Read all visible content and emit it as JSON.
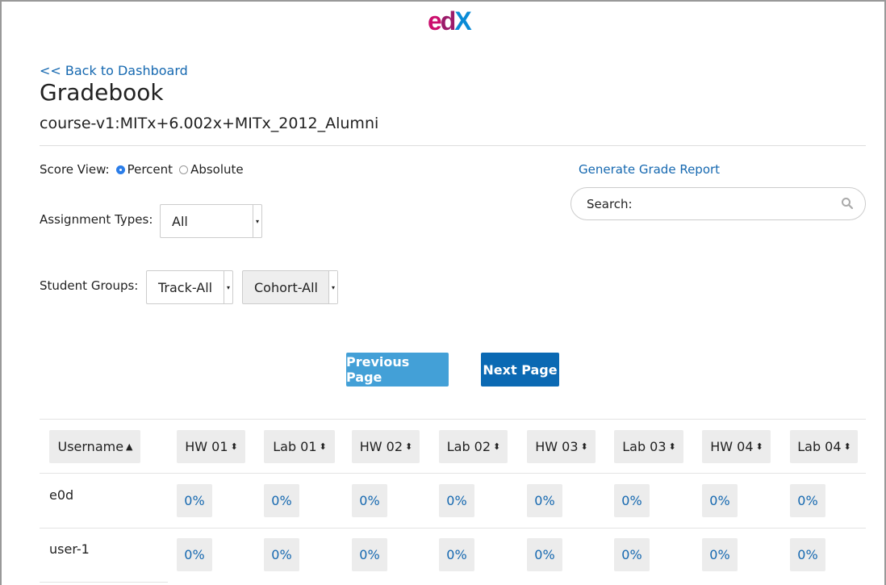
{
  "logo": {
    "e": "e",
    "d": "d",
    "x": "X"
  },
  "nav": {
    "back_label": "<< Back to Dashboard"
  },
  "page": {
    "title": "Gradebook",
    "course_id": "course-v1:MITx+6.002x+MITx_2012_Alumni"
  },
  "score_view": {
    "label": "Score View:",
    "options": [
      "Percent",
      "Absolute"
    ],
    "selected": "Percent"
  },
  "report": {
    "label": "Generate Grade Report"
  },
  "search": {
    "label": "Search:"
  },
  "filters": {
    "assignment_types_label": "Assignment Types:",
    "assignment_types_value": "All",
    "student_groups_label": "Student Groups:",
    "track_value": "Track-All",
    "cohort_value": "Cohort-All"
  },
  "pagination": {
    "prev_label": "Previous Page",
    "next_label": "Next Page"
  },
  "table": {
    "username_header": "Username",
    "columns": [
      "HW 01",
      "Lab 01",
      "HW 02",
      "Lab 02",
      "HW 03",
      "Lab 03",
      "HW 04",
      "Lab 04"
    ],
    "rows": [
      {
        "username": "e0d",
        "grades": [
          "0%",
          "0%",
          "0%",
          "0%",
          "0%",
          "0%",
          "0%",
          "0%"
        ]
      },
      {
        "username": "user-1",
        "grades": [
          "0%",
          "0%",
          "0%",
          "0%",
          "0%",
          "0%",
          "0%",
          "0%"
        ]
      }
    ]
  },
  "colors": {
    "link": "#1568b0",
    "prev_button": "#43a0d7",
    "next_button": "#0b69b3",
    "radio_selected": "#2b7de9"
  }
}
